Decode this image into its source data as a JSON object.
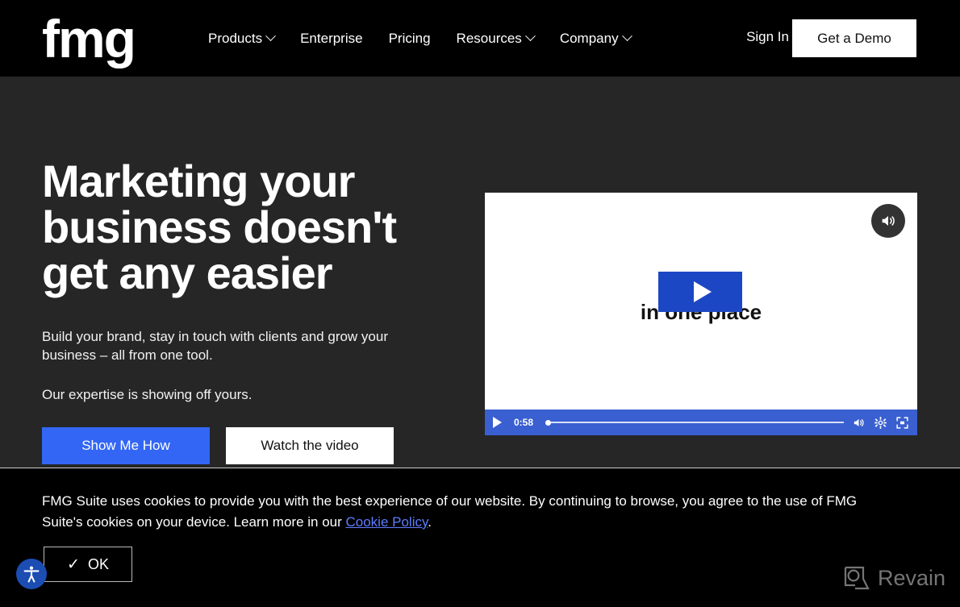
{
  "header": {
    "logo_text": "fmg",
    "logo_icon": "fmg-wordmark-logo",
    "nav_items": [
      {
        "label": "Products",
        "has_dropdown": true
      },
      {
        "label": "Enterprise",
        "has_dropdown": false
      },
      {
        "label": "Pricing",
        "has_dropdown": false
      },
      {
        "label": "Resources",
        "has_dropdown": true
      },
      {
        "label": "Company",
        "has_dropdown": true
      }
    ],
    "sign_in_label": "Sign In",
    "demo_button_label": "Get a Demo",
    "background_color": "#000000"
  },
  "hero": {
    "title": "Marketing your business doesn't get any easier",
    "subtitle": "Build your brand, stay in touch with clients and grow your business – all from one tool.",
    "subtitle2": "Our expertise is showing off yours.",
    "primary_cta": "Show Me How",
    "secondary_cta": "Watch the video",
    "primary_cta_color": "#3366f5",
    "background_color": "#262626"
  },
  "video": {
    "caption": "in one place",
    "play_icon": "play-icon",
    "unmute_icon": "volume-on-icon",
    "controls": {
      "play_icon": "play-icon",
      "time": "0:58",
      "progress_percent": 0,
      "volume_icon": "volume-icon",
      "settings_icon": "gear-icon",
      "fullscreen_icon": "fullscreen-icon",
      "bar_color": "#3a5fd0"
    }
  },
  "cookie_banner": {
    "text_part1": "FMG Suite uses cookies to provide you with the best experience of our website. By continuing to browse, you agree to the use of FMG Suite's cookies on your device. Learn more in our ",
    "link_label": "Cookie Policy",
    "text_part2": ".",
    "ok_label": "OK",
    "ok_icon": "checkmark-icon",
    "link_color": "#5d7cff"
  },
  "accessibility_widget": {
    "icon": "accessibility-person-icon",
    "color": "#1b4db3"
  },
  "watermark": {
    "label": "Revain",
    "icon": "revain-logo-icon"
  }
}
